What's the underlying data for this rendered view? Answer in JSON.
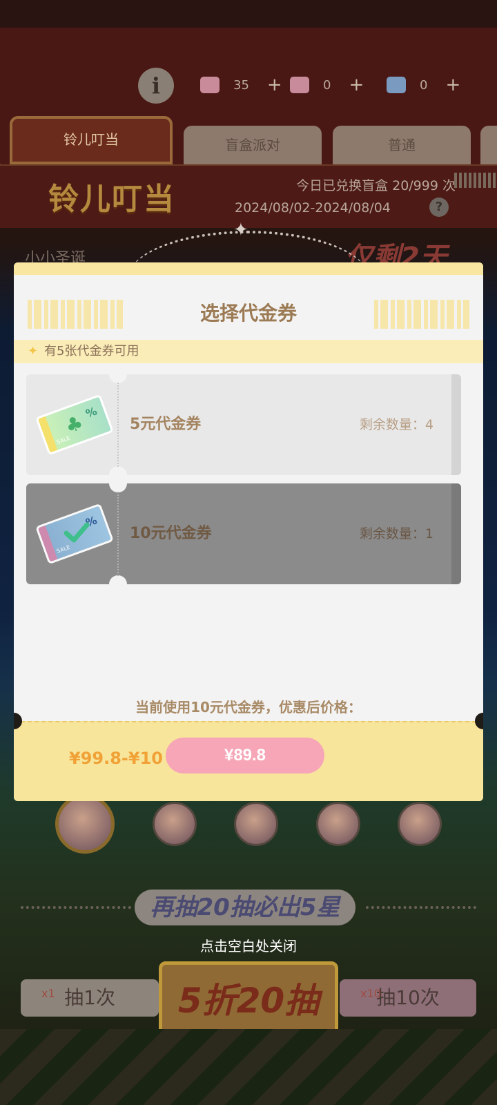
{
  "header": {
    "info_icon_label": "i",
    "currencies": [
      {
        "icon": "star-ticket-icon",
        "value": "35",
        "color": "#c98a9a"
      },
      {
        "icon": "pink-ticket-icon",
        "value": "0",
        "color": "#c78b9b"
      },
      {
        "icon": "blue-ticket-icon",
        "value": "0",
        "color": "#7a9ac0"
      }
    ],
    "plus_label": "+"
  },
  "tabs": [
    {
      "label": "铃儿叮当",
      "active": true
    },
    {
      "label": "盲盒派对",
      "active": false
    },
    {
      "label": "普通",
      "active": false
    }
  ],
  "banner": {
    "title": "铃儿叮当",
    "exchange_count": "今日已兑换盲盒 20/999 次",
    "date_range": "2024/08/02-2024/08/04",
    "help_label": "?"
  },
  "background": {
    "left_text": "小小圣诞",
    "right_text": "仅剩2天"
  },
  "modal": {
    "title": "选择代金券",
    "available_hint": "有5张代金券可用",
    "coupons": [
      {
        "name": "5元代金券",
        "remaining_label": "剩余数量：4",
        "selected": false,
        "icon": "green-voucher-ticket-icon"
      },
      {
        "name": "10元代金券",
        "remaining_label": "剩余数量：1",
        "selected": true,
        "icon": "blue-voucher-ticket-icon"
      }
    ],
    "selected_info": "当前使用10元代金券，优惠后价格：",
    "price_formula": "¥99.8-¥10",
    "final_price": "¥89.8"
  },
  "bottom": {
    "pity_text": "再抽20抽必出5星",
    "close_hint": "点击空白处关闭",
    "draw1_label": "抽1次",
    "draw1_count": "x1",
    "center_label": "5折20抽",
    "draw10_label": "抽10次",
    "draw10_count": "x10",
    "back_icon_label": "⇠"
  },
  "colors": {
    "accent_gold": "#f8e59c",
    "price_pink": "#f6a6b6",
    "title_brown": "#9b7a54"
  }
}
